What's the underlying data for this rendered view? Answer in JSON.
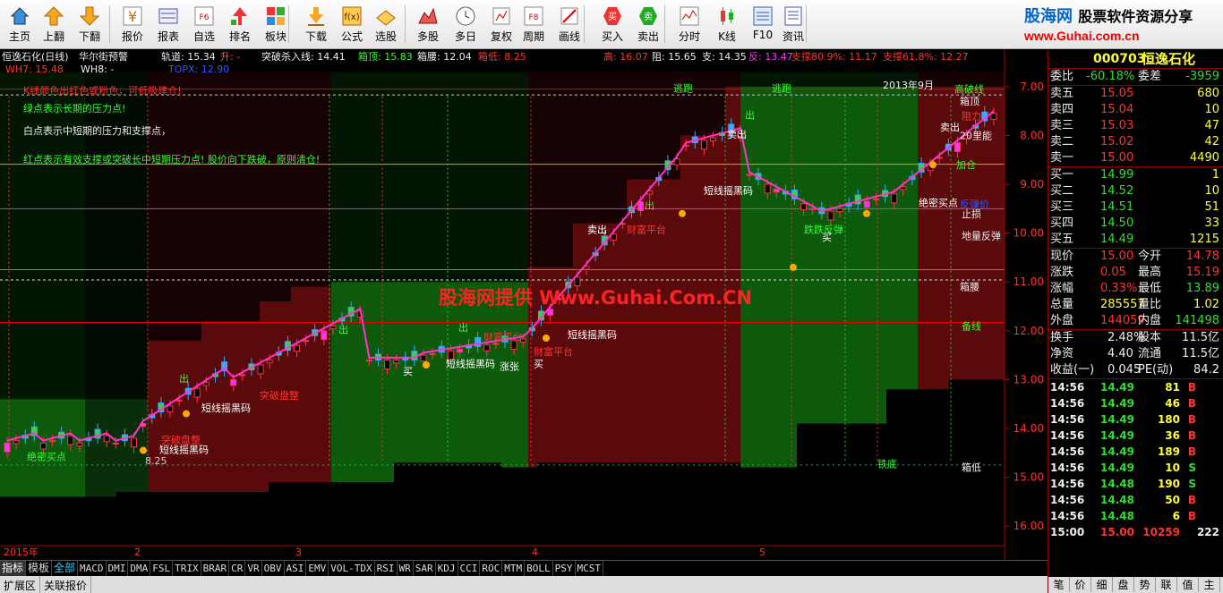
{
  "toolbar": {
    "buttons": [
      {
        "label": "主页",
        "icon": "home-icon"
      },
      {
        "label": "上翻",
        "icon": "arrow-up-icon"
      },
      {
        "label": "下翻",
        "icon": "arrow-down-icon"
      },
      {
        "label": "报价",
        "icon": "yen-quote-icon"
      },
      {
        "label": "报表",
        "icon": "report-icon"
      },
      {
        "label": "自选",
        "icon": "f6-icon"
      },
      {
        "label": "排名",
        "icon": "ranking-icon"
      },
      {
        "label": "板块",
        "icon": "sector-icon"
      },
      {
        "label": "下载",
        "icon": "download-icon"
      },
      {
        "label": "公式",
        "icon": "formula-icon"
      },
      {
        "label": "选股",
        "icon": "stock-pick-icon"
      },
      {
        "label": "多股",
        "icon": "multi-stock-icon"
      },
      {
        "label": "多日",
        "icon": "clock-icon"
      },
      {
        "label": "复权",
        "icon": "restore-rights-icon"
      },
      {
        "label": "周期",
        "icon": "f8-icon"
      },
      {
        "label": "画线",
        "icon": "draw-line-icon"
      },
      {
        "label": "买入",
        "icon": "buy-icon"
      },
      {
        "label": "卖出",
        "icon": "sell-icon"
      },
      {
        "label": "分时",
        "icon": "intraday-icon"
      },
      {
        "label": "K线",
        "icon": "kline-icon"
      },
      {
        "label": "F10",
        "icon": "f10-icon"
      },
      {
        "label": "资讯",
        "icon": "news-icon"
      }
    ],
    "brand_name": "股海网",
    "brand_slogan": "股票软件资源分享",
    "brand_url": "www.Guhai.com.cn"
  },
  "chart": {
    "stock_title": "恒逸石化(日线)",
    "indicator_name": "华尔街预警",
    "track": "轨道: 15.34",
    "track_dir": "升: -",
    "breakout_line": "突破杀入线: 14.41",
    "box_top": "箱顶: 15.83",
    "box_waist": "箱腰: 12.04",
    "box_bottom": "箱低: 8.25",
    "high": "高: 16.07",
    "resist": "阻: 15.65",
    "support": "支: 14.35",
    "rebound": "反: 13.47",
    "support_809": "支撑80.9%: 11.17",
    "support_618": "支撑61.8%: 12.27",
    "wh7": "WH7: 15.48",
    "wh8": "WH8: -",
    "topx": "TOPX: 12.90",
    "notes": [
      "K线颜色出红色或粉色，可低吸建仓!",
      "绿点表示长期的压力点!",
      "白点表示中短期的压力和支撑点，",
      "红点表示有效支撑或突破长中短期压力点! 股价向下跌破，原则清仓!"
    ],
    "watermark": "股海网提供 Www.Guhai.Com.CN",
    "year_label": "2015年",
    "month_labels": [
      "2",
      "3",
      "4",
      "5"
    ],
    "annotation_2013": "2013年9月",
    "y_ticks": [
      "16.00",
      "15.00",
      "14.00",
      "13.00",
      "12.00",
      "11.00",
      "10.00",
      "9.00",
      "8.00",
      "7.00"
    ],
    "right_labels": [
      "高破线",
      "箱顶",
      "阻力",
      "20里能",
      "加仓",
      "止损",
      "地量反弹",
      "箱腰",
      "备线",
      "箱低",
      "反弹价"
    ],
    "signals": [
      "短线摇黑码",
      "突破盘整",
      "财富平台",
      "买",
      "出",
      "卖出",
      "跌跌反弹",
      "铁底",
      "绝密买点",
      "逃跑",
      "涨张"
    ],
    "low_marker": "8.25",
    "period": "日线"
  },
  "chart_data": {
    "type": "candlestick",
    "ylim": [
      6.6,
      16.4
    ],
    "y_ticks": [
      7,
      8,
      9,
      10,
      11,
      12,
      13,
      14,
      15,
      16
    ],
    "x_labels": [
      "2015年",
      "2",
      "3",
      "4",
      "5"
    ],
    "lines": [
      {
        "name": "箱顶",
        "value": 15.83
      },
      {
        "name": "箱腰",
        "value": 12.04
      },
      {
        "name": "箱低",
        "value": 8.25
      }
    ]
  },
  "tabs": [
    "指标",
    "模板",
    "全部",
    "MACD",
    "DMI",
    "DMA",
    "FSL",
    "TRIX",
    "BRAR",
    "CR",
    "VR",
    "OBV",
    "ASI",
    "EMV",
    "VOL-TDX",
    "RSI",
    "WR",
    "SAR",
    "KDJ",
    "CCI",
    "ROC",
    "MTM",
    "BOLL",
    "PSY",
    "MCST"
  ],
  "status_tabs": [
    "扩展区",
    "关联报价"
  ],
  "panel": {
    "code": "000703",
    "name": "恒逸石化",
    "weibi_label": "委比",
    "weibi": "-60.18%",
    "weicha_label": "委差",
    "weicha": "-3959",
    "asks": [
      {
        "label": "卖五",
        "price": "15.05",
        "vol": "680"
      },
      {
        "label": "卖四",
        "price": "15.04",
        "vol": "10"
      },
      {
        "label": "卖三",
        "price": "15.03",
        "vol": "47"
      },
      {
        "label": "卖二",
        "price": "15.02",
        "vol": "42"
      },
      {
        "label": "卖一",
        "price": "15.00",
        "vol": "4490"
      }
    ],
    "bids": [
      {
        "label": "买一",
        "price": "14.99",
        "vol": "1"
      },
      {
        "label": "买二",
        "price": "14.52",
        "vol": "10"
      },
      {
        "label": "买三",
        "price": "14.51",
        "vol": "51"
      },
      {
        "label": "买四",
        "price": "14.50",
        "vol": "33"
      },
      {
        "label": "买五",
        "price": "14.49",
        "vol": "1215"
      }
    ],
    "stats": [
      {
        "l1": "现价",
        "v1": "15.00",
        "l2": "今开",
        "v2": "14.78"
      },
      {
        "l1": "涨跌",
        "v1": "0.05",
        "l2": "最高",
        "v2": "15.19"
      },
      {
        "l1": "涨幅",
        "v1": "0.33%",
        "l2": "最低",
        "v2": "13.89"
      },
      {
        "l1": "总量",
        "v1": "285557",
        "l2": "量比",
        "v2": "1.02"
      },
      {
        "l1": "外盘",
        "v1": "144059",
        "l2": "内盘",
        "v2": "141498"
      }
    ],
    "stats2": [
      {
        "l1": "换手",
        "v1": "2.48%",
        "l2": "股本",
        "v2": "11.5亿"
      },
      {
        "l1": "净资",
        "v1": "4.40",
        "l2": "流通",
        "v2": "11.5亿"
      },
      {
        "l1": "收益(一)",
        "v1": "0.045",
        "l2": "PE(动)",
        "v2": "84.2"
      }
    ],
    "ticks": [
      {
        "t": "14:56",
        "p": "14.49",
        "v": "81",
        "s": "B"
      },
      {
        "t": "14:56",
        "p": "14.49",
        "v": "46",
        "s": "B"
      },
      {
        "t": "14:56",
        "p": "14.49",
        "v": "180",
        "s": "B"
      },
      {
        "t": "14:56",
        "p": "14.49",
        "v": "36",
        "s": "B"
      },
      {
        "t": "14:56",
        "p": "14.49",
        "v": "189",
        "s": "B"
      },
      {
        "t": "14:56",
        "p": "14.49",
        "v": "10",
        "s": "S"
      },
      {
        "t": "14:56",
        "p": "14.48",
        "v": "190",
        "s": "S"
      },
      {
        "t": "14:56",
        "p": "14.48",
        "v": "50",
        "s": "B"
      },
      {
        "t": "14:56",
        "p": "14.48",
        "v": "6",
        "s": "B"
      },
      {
        "t": "15:00",
        "p": "15.00",
        "v": "10259",
        "s": "222"
      }
    ],
    "bottom_tabs": [
      "笔",
      "价",
      "细",
      "盘",
      "势",
      "联",
      "值",
      "主"
    ]
  }
}
